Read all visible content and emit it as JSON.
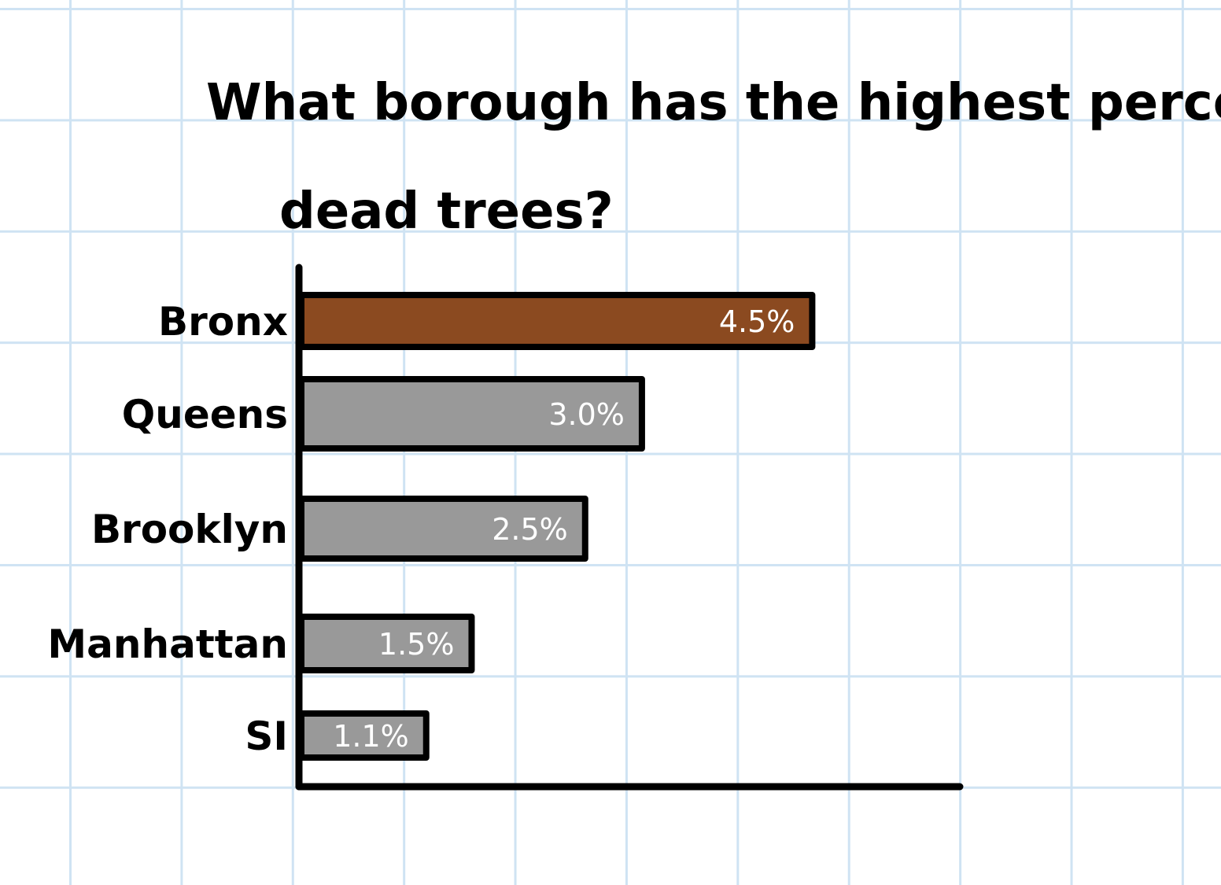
{
  "chart_data": {
    "type": "bar",
    "orientation": "horizontal",
    "title_lines": [
      "What borough has the highest percentage of",
      "dead trees?"
    ],
    "categories": [
      "Bronx",
      "Queens",
      "Brooklyn",
      "Manhattan",
      "SI"
    ],
    "values": [
      4.5,
      3.0,
      2.5,
      1.5,
      1.1
    ],
    "data_labels": [
      "4.5%",
      "3.0%",
      "2.5%",
      "1.5%",
      "1.1%"
    ],
    "highlight_category": "Bronx",
    "xlabel": "",
    "ylabel": "",
    "xlim": [
      0,
      5.8
    ],
    "grid": true,
    "colors": {
      "highlight": "#8b4a20",
      "default": "#999999",
      "outline": "#000000",
      "label": "#ffffff",
      "grid": "#cfe3f3"
    }
  }
}
